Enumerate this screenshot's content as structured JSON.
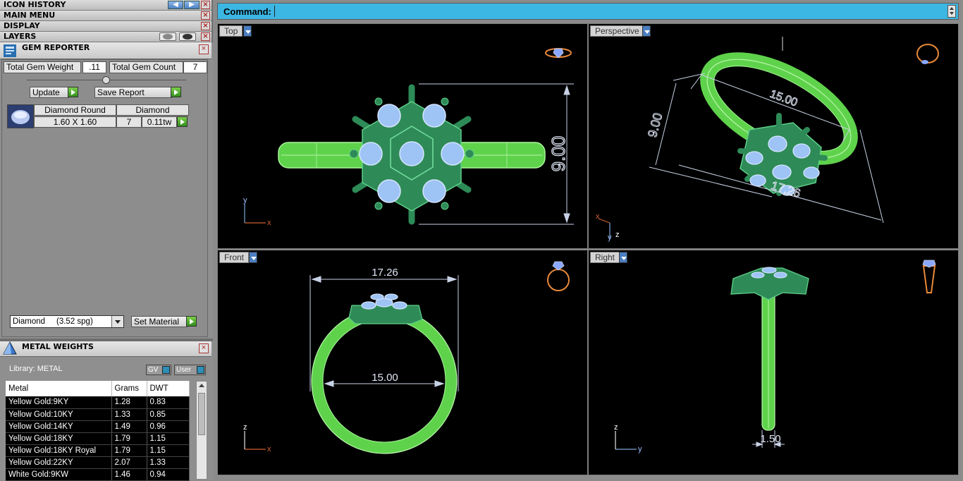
{
  "panels": {
    "icon_history": "ICON HISTORY",
    "main_menu": "MAIN MENU",
    "display": "DISPLAY",
    "layers": "LAYERS"
  },
  "gem_reporter": {
    "title": "GEM REPORTER",
    "total_weight_label": "Total Gem Weight",
    "total_weight_value": ".11",
    "total_count_label": "Total Gem Count",
    "total_count_value": "7",
    "update_label": "Update",
    "save_report_label": "Save Report",
    "gem": {
      "name": "Diamond Round",
      "material": "Diamond",
      "size": "1.60 X 1.60",
      "count": "7",
      "weight": "0.11tw"
    },
    "material_select": "Diamond     (3.52 spg)",
    "set_material_label": "Set Material"
  },
  "metal_weights": {
    "title": "METAL WEIGHTS",
    "library_label": "Library: METAL",
    "gv_label": "GV",
    "user_label": "User",
    "columns": [
      "Metal",
      "Grams",
      "DWT"
    ],
    "rows": [
      [
        "Yellow Gold:9KY",
        "1.28",
        "0.83"
      ],
      [
        "Yellow Gold:10KY",
        "1.33",
        "0.85"
      ],
      [
        "Yellow Gold:14KY",
        "1.49",
        "0.96"
      ],
      [
        "Yellow Gold:18KY",
        "1.79",
        "1.15"
      ],
      [
        "Yellow Gold:18KY Royal",
        "1.79",
        "1.15"
      ],
      [
        "Yellow Gold:22KY",
        "2.07",
        "1.33"
      ],
      [
        "White Gold:9KW",
        "1.46",
        "0.94"
      ]
    ]
  },
  "command": {
    "label": "Command:",
    "value": ""
  },
  "viewports": {
    "top": {
      "label": "Top",
      "dim_height": "9.00",
      "axis_x": "x",
      "axis_y": "y"
    },
    "perspective": {
      "label": "Perspective",
      "dim_a": "15.00",
      "dim_b": "9.00",
      "dim_c": "17.26",
      "axis_x": "x",
      "axis_y": "y",
      "axis_z": "z"
    },
    "front": {
      "label": "Front",
      "dim_outer": "17.26",
      "dim_inner": "15.00",
      "axis_x": "x",
      "axis_z": "z"
    },
    "right": {
      "label": "Right",
      "dim_width": "1.50",
      "axis_y": "y",
      "axis_z": "z"
    }
  },
  "colors": {
    "command_bar": "#3cb6e2",
    "band": "#7de86a",
    "setting": "#2e8b57",
    "gem": "#9ec3f5",
    "dimension": "#c8d2e6",
    "viewport_bg": "#000000"
  }
}
